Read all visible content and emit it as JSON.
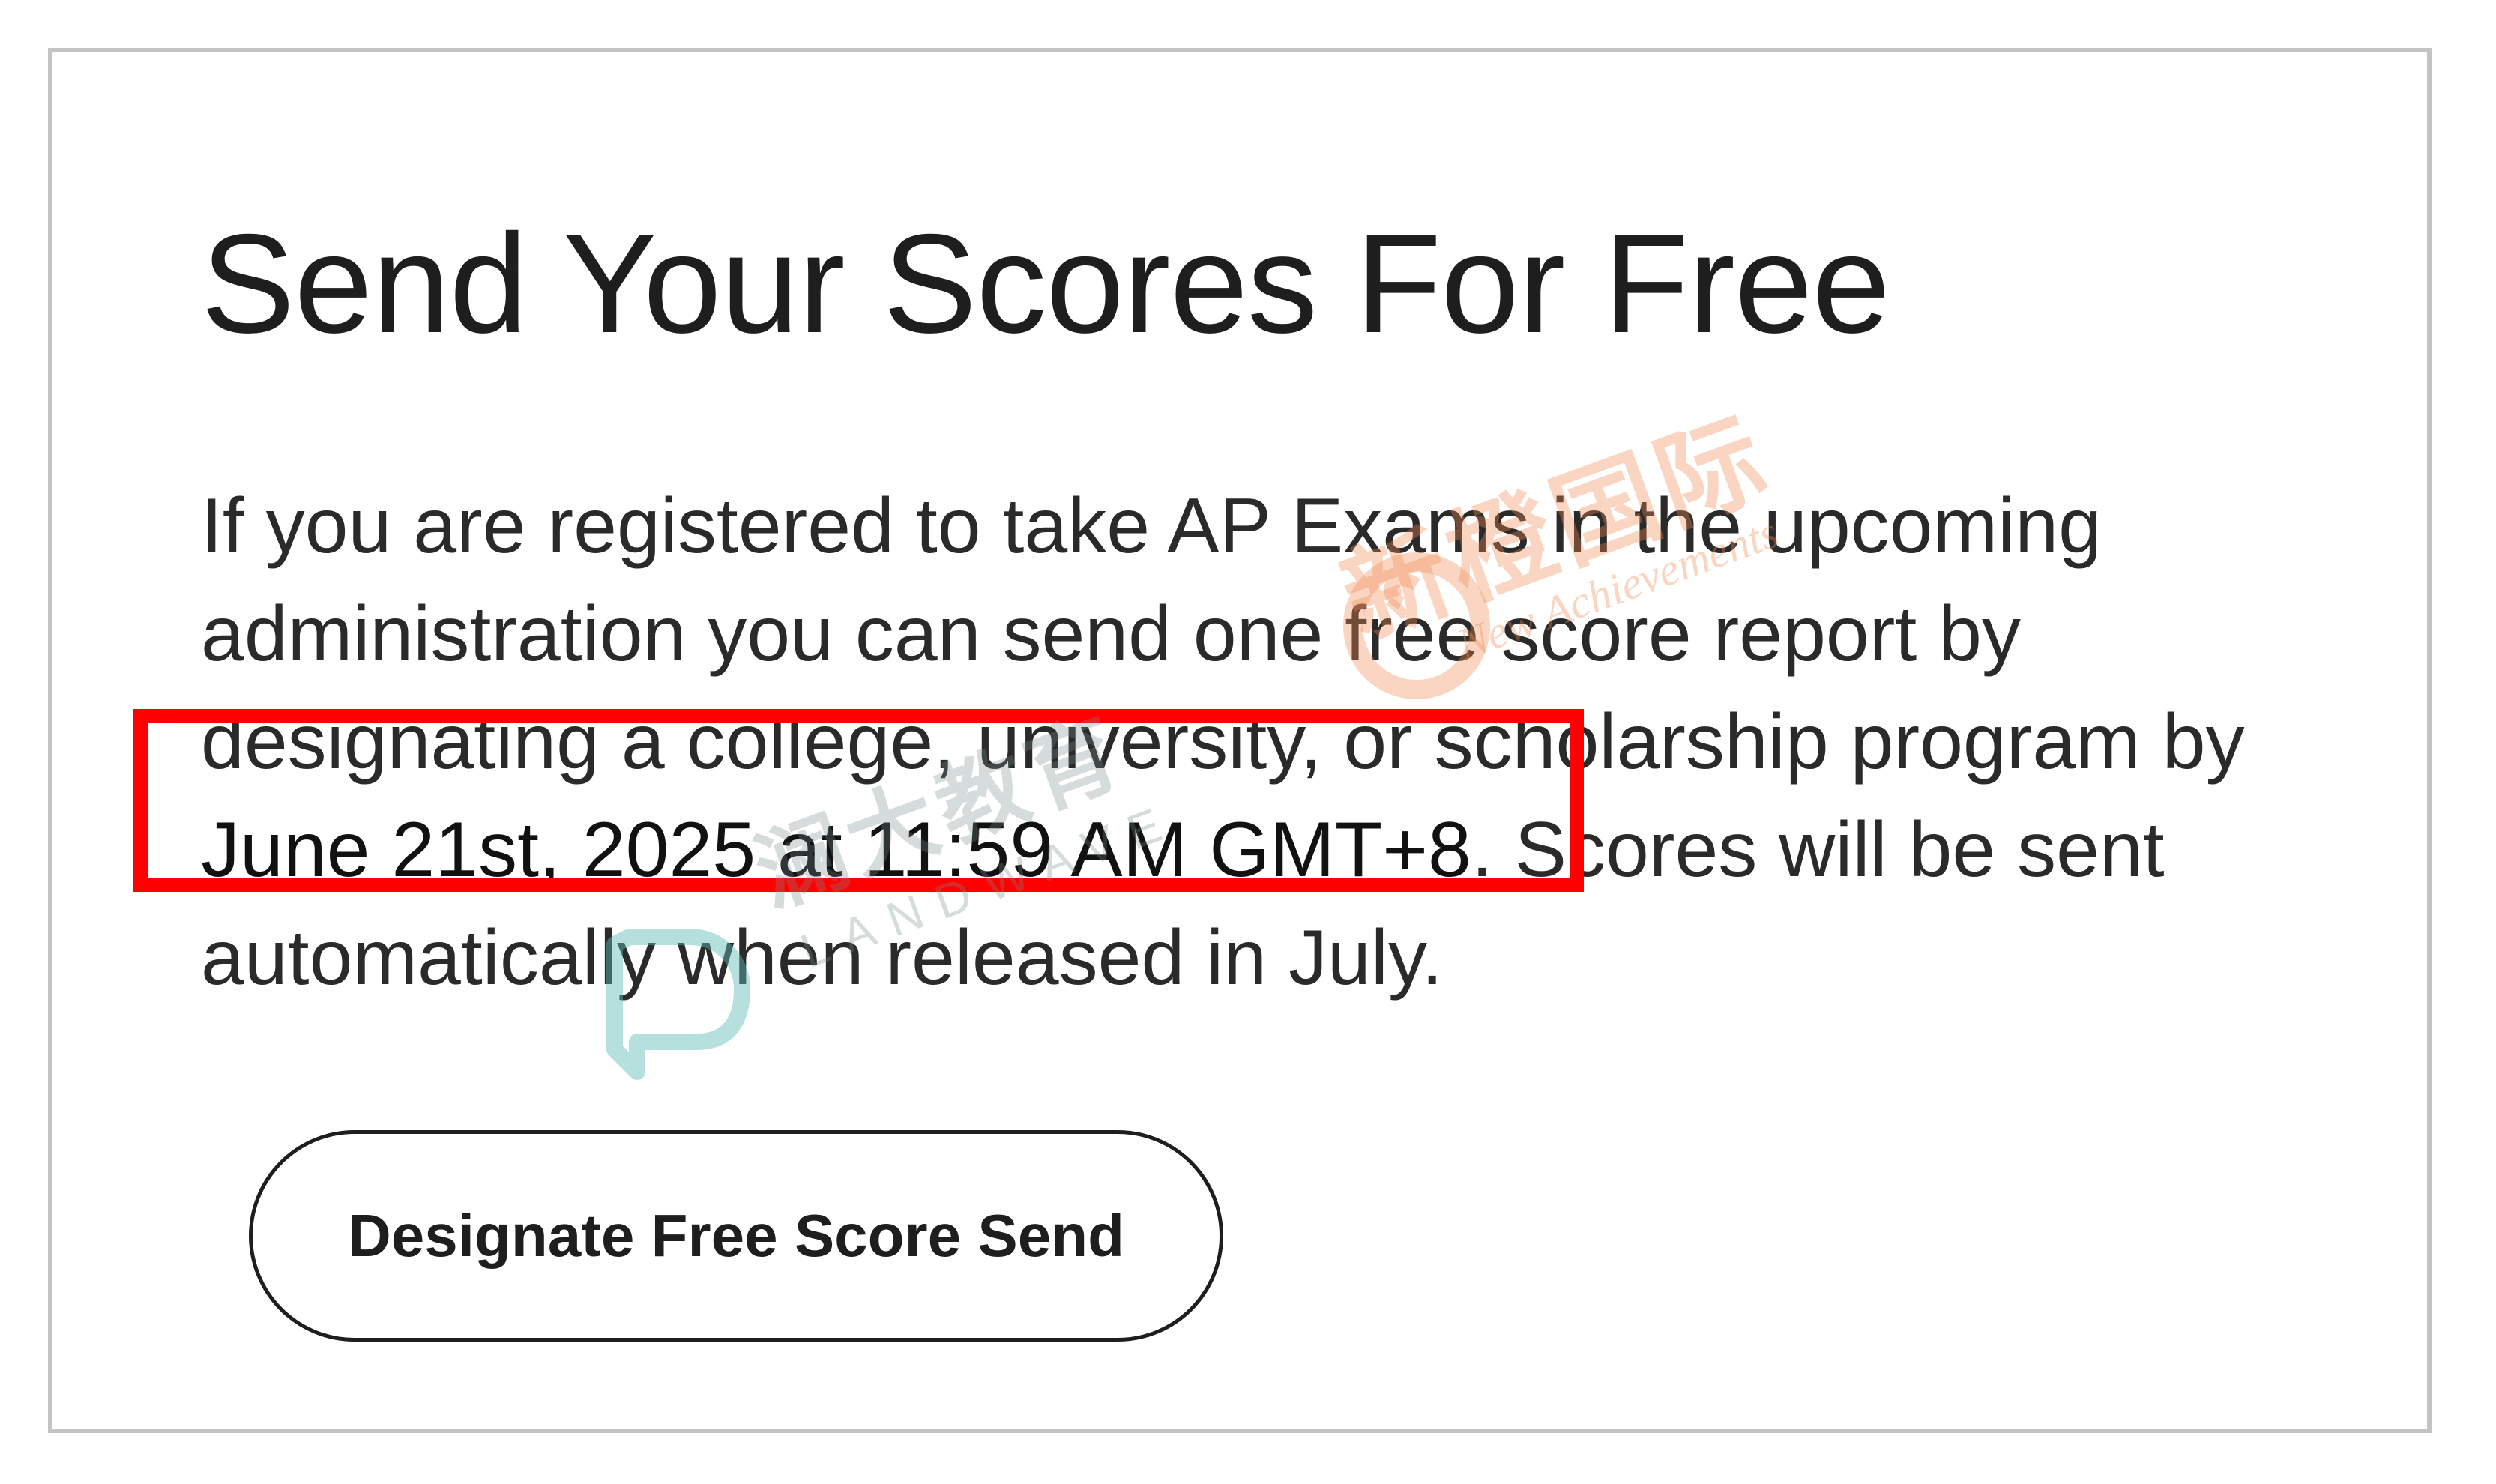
{
  "card": {
    "title": "Send Your Scores For Free",
    "body": {
      "line1": "If you are registered to take AP Exams in the upcoming",
      "line2": "administration you can send one free score report by",
      "line3": "designating a college, university, or scholarship program by",
      "deadline": "June 21st, 2025 at 11:59 AM GMT+8",
      "line4_rest": ". Scores will be sent",
      "line5": "automatically when released in July."
    },
    "button_label": "Designate Free Score Send"
  },
  "watermarks": {
    "orange_cn": "新橙国际",
    "orange_en": "New Achievements",
    "teal_cn": "澜大教育",
    "teal_en": "LANDWAVE"
  },
  "colors": {
    "highlight": "#ff0000",
    "text": "#1e1e1e",
    "border": "#c4c4c4"
  }
}
